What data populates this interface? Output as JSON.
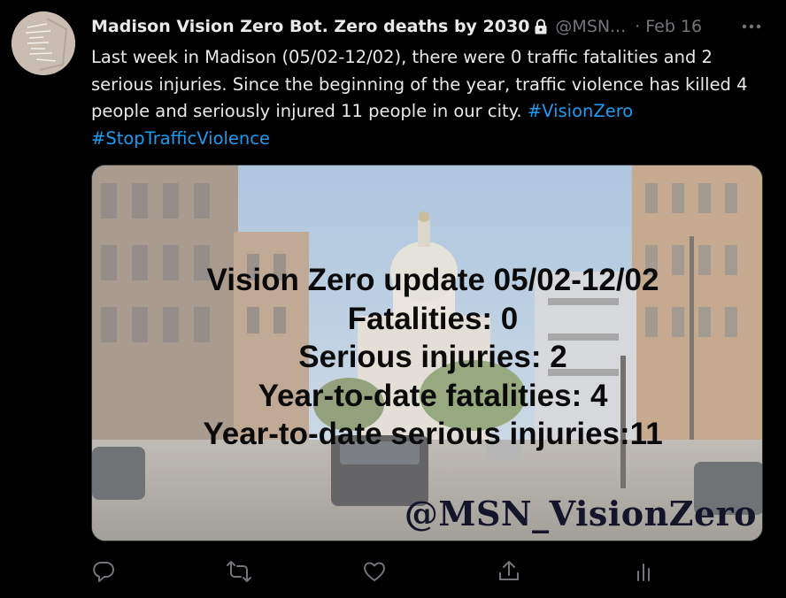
{
  "author": {
    "display_name": "Madison Vision Zero Bot. Zero deaths by 2030",
    "handle": "@MSN...",
    "separator": "·",
    "date": "Feb 16",
    "protected_icon": "lock-icon",
    "avatar_icon": "avatar-photo"
  },
  "tweet": {
    "text_main": "Last week in Madison (05/02-12/02), there were 0 traffic fatalities and 2 serious injuries. Since the beginning of the year, traffic violence has killed 4 people and seriously injured 11 people in our city. ",
    "hashtags": [
      "#VisionZero",
      "#StopTrafficViolence"
    ]
  },
  "media": {
    "lines": [
      "Vision Zero update 05/02-12/02",
      "Fatalities: 0",
      "Serious injuries: 2",
      "Year-to-date fatalities: 4",
      "Year-to-date serious injuries:11"
    ],
    "watermark": "@MSN_VisionZero"
  },
  "actions": {
    "icons": [
      "reply-icon",
      "retweet-icon",
      "like-icon",
      "share-icon",
      "analytics-icon"
    ]
  },
  "colors": {
    "background": "#000000",
    "text": "#e7e9ea",
    "muted": "#71767b",
    "accent": "#1d9bf0"
  }
}
